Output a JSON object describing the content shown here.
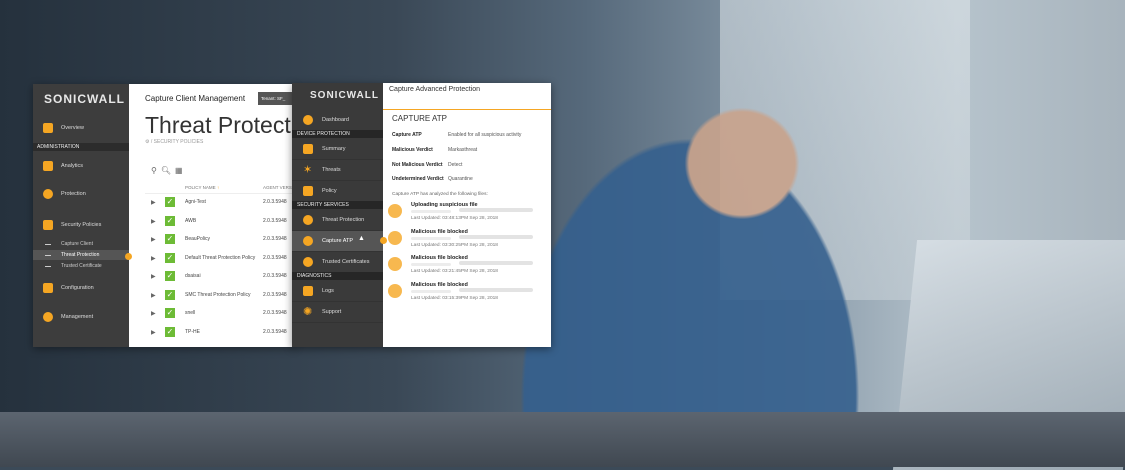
{
  "panel1": {
    "logo": "SONICWALL",
    "title": "Capture Client Management",
    "tenant_label": "Tenant: SF_",
    "page_title": "Threat Protection",
    "breadcrumb": "/ SECURITY POLICIES",
    "table_headers": [
      "POLICY NAME",
      "AGENT VERSI"
    ],
    "sidebar": {
      "overview": "Overview",
      "administration_header": "ADMINISTRATION",
      "analytics": "Analytics",
      "protection": "Protection",
      "security_policies": "Security Policies",
      "sub_capture_client": "Capture Client",
      "sub_threat_protection": "Threat Protection",
      "sub_trusted_certificates": "Trusted Certificate",
      "configuration": "Configuration",
      "management": "Management"
    },
    "rows": [
      {
        "name": "Agni-Test",
        "version": "2.0.3.5948"
      },
      {
        "name": "AWB",
        "version": "2.0.3.5948"
      },
      {
        "name": "BeauPolicy",
        "version": "2.0.3.5948"
      },
      {
        "name": "Default Threat Protection Policy",
        "version": "2.0.3.5948"
      },
      {
        "name": "dsaisai",
        "version": "2.0.3.5948"
      },
      {
        "name": "SMC Threat Protection Policy",
        "version": "2.0.3.5948"
      },
      {
        "name": "snell",
        "version": "2.0.3.5948"
      },
      {
        "name": "TP-HE",
        "version": "2.0.3.5948"
      }
    ]
  },
  "panel2": {
    "logo": "SONICWALL",
    "title": "Capture Advanced Protection",
    "subtitle": "CAPTURE ATP",
    "sidebar": {
      "dashboard": "Dashboard",
      "device_protection_header": "DEVICE PROTECTION",
      "summary": "Summary",
      "threats": "Threats",
      "policy": "Policy",
      "security_services_header": "SECURITY SERVICES",
      "threat_protection": "Threat Protection",
      "capture_atp": "Capture ATP",
      "trusted_certificates": "Trusted Certificates",
      "diagnostics_header": "DIAGNOSTICS",
      "logs": "Logs",
      "support": "Support"
    },
    "settings": [
      {
        "key": "Capture ATP",
        "value": "Enabled for all suspicious activity"
      },
      {
        "key": "Malicious Verdict",
        "value": "Markasthreat"
      },
      {
        "key": "Not Malicious Verdict",
        "value": "Detect"
      },
      {
        "key": "Undetermined Verdict",
        "value": "Quarantine"
      }
    ],
    "analyzed_note": "Capture ATP has analyzed the following files:",
    "files": [
      {
        "status": "Uploading suspicious file",
        "updated": "Last Updated: 03:48:13PM Sep 28, 2018"
      },
      {
        "status": "Malicious file blocked",
        "updated": "Last Updated: 03:30:25PM Sep 28, 2018"
      },
      {
        "status": "Malicious file blocked",
        "updated": "Last Updated: 03:21:45PM Sep 28, 2018"
      },
      {
        "status": "Malicious file blocked",
        "updated": "Last Updated: 03:15:39PM Sep 28, 2018"
      }
    ]
  },
  "colors": {
    "accent": "#f5a623",
    "check": "#6dbb36",
    "sidebar": "#3d3d3d"
  }
}
